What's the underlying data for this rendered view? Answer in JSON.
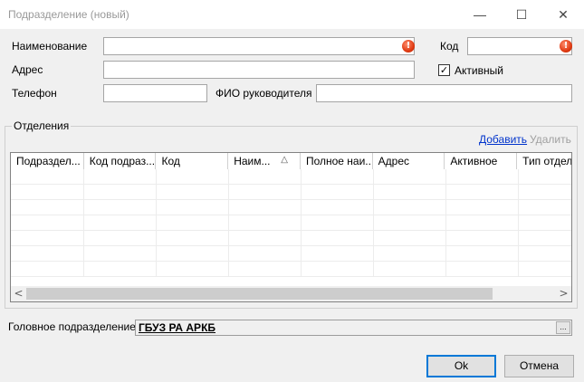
{
  "window": {
    "title": "Подразделение (новый)",
    "minimize_glyph": "—",
    "maximize_glyph": "☐",
    "close_glyph": "✕"
  },
  "form": {
    "name_label": "Наименование",
    "name_value": "",
    "code_label": "Код",
    "code_value": "",
    "address_label": "Адрес",
    "address_value": "",
    "active_label": "Активный",
    "active_checked": true,
    "phone_label": "Телефон",
    "phone_value": "",
    "head_label": "ФИО руководителя",
    "head_value": "",
    "error_glyph": "!",
    "check_glyph": "✓"
  },
  "departments": {
    "group_title": "Отделения",
    "add_link": "Добавить",
    "delete_link": "Удалить",
    "columns": [
      "Подраздел...",
      "Код подраз...",
      "Код",
      "Наим...",
      "Полное наи...",
      "Адрес",
      "Активное",
      "Тип отделе"
    ],
    "sort_glyph": "△",
    "scroll_left_glyph": "<",
    "scroll_right_glyph": ">"
  },
  "parent": {
    "label": "Головное подразделение",
    "value": "ГБУЗ РА АРКБ",
    "ellipsis": "..."
  },
  "buttons": {
    "ok": "Ok",
    "cancel": "Отмена"
  }
}
